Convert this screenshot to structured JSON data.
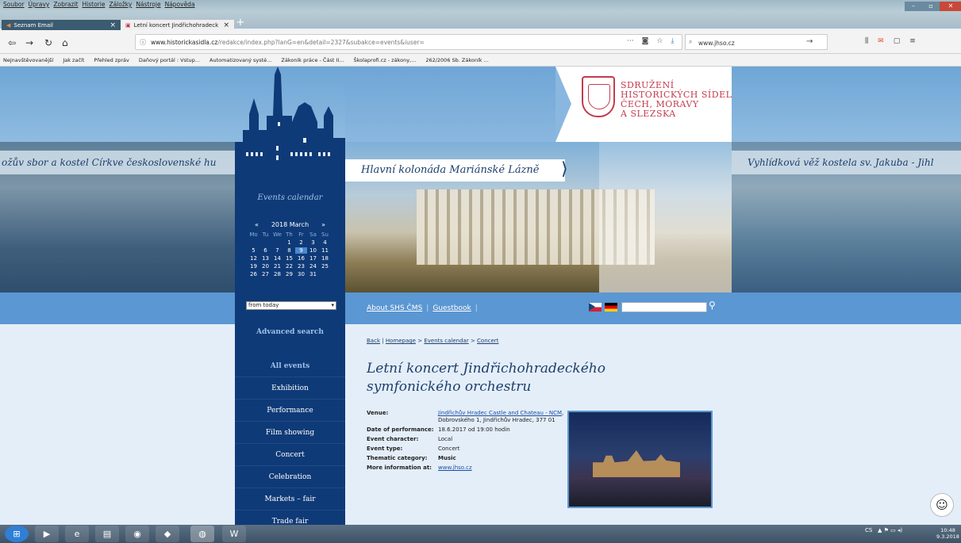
{
  "browser": {
    "menu": [
      "Soubor",
      "Úpravy",
      "Zobrazit",
      "Historie",
      "Záložky",
      "Nástroje",
      "Nápověda"
    ],
    "tabs": [
      {
        "label": "Seznam Email"
      },
      {
        "label": "Letní koncert Jindřichohradeck"
      }
    ],
    "url_domain": "www.historickasidla.cz",
    "url_path": "/redakce/index.php?lanG=en&detail=2327&subakce=events&iuser=",
    "search_value": "www.jhso.cz",
    "bookmarks": [
      "Nejnavštěvovanější",
      "Jak začít",
      "Přehled zpráv",
      "Daňový portál : Vstup...",
      "Automatizovaný systé...",
      "Zákoník práce - Část II...",
      "Školaprofi.cz - zákony,...",
      "262/2006 Sb. Zákoník ..."
    ]
  },
  "header": {
    "org_lines": [
      "SDRUŽENÍ",
      "HISTORICKÝCH SÍDEL",
      "ČECH, MORAVY",
      "A SLEZSKA"
    ],
    "caption_left": "ožův sbor a kostel Církve československé hu",
    "caption_main": "Hlavní kolonáda Mariánské Lázně",
    "caption_right": "Vyhlídková věž kostela sv. Jakuba - Jihl"
  },
  "calendar": {
    "title": "Events calendar",
    "prev": "«",
    "month": "2018 March",
    "next": "»",
    "weekdays": [
      "Mo",
      "Tu",
      "We",
      "Th",
      "Fr",
      "Sa",
      "Su"
    ],
    "days": [
      "",
      "",
      "",
      "1",
      "2",
      "3",
      "4",
      "5",
      "6",
      "7",
      "8",
      "9",
      "10",
      "11",
      "12",
      "13",
      "14",
      "15",
      "16",
      "17",
      "18",
      "19",
      "20",
      "21",
      "22",
      "23",
      "24",
      "25",
      "26",
      "27",
      "28",
      "29",
      "30",
      "31",
      ""
    ],
    "today": "9",
    "filter": "from today"
  },
  "topnav": {
    "about": "About SHS ČMS",
    "guestbook": "Guestbook",
    "sep": "|"
  },
  "sidenav": {
    "advanced": "Advanced search",
    "categories": [
      "All events",
      "Exhibition",
      "Performance",
      "Film showing",
      "Concert",
      "Celebration",
      "Markets – fair",
      "Trade fair"
    ]
  },
  "event": {
    "crumb_back": "Back",
    "crumb_home": "Homepage",
    "crumb_cal": "Events calendar",
    "crumb_current": "Concert",
    "crumb_sep1": "|",
    "crumb_sep2": ">",
    "title_line1": "Letní koncert Jindřichohradeckého",
    "title_line2": "symfonického orchestru",
    "venue_label": "Venue:",
    "venue_link": "Jindřichův Hradec Castle and Chateau - NCM",
    "venue_address": ", Dobrovského 1, Jindřichův Hradec, 377 01",
    "date_label": "Date of performance:",
    "date_value": "18.6.2017 od 19:00 hodin",
    "character_label": "Event character:",
    "character_value": "Local",
    "type_label": "Event type:",
    "type_value": "Concert",
    "thematic_label": "Thematic category:",
    "thematic_value": "Music",
    "more_label": "More information at:",
    "more_link": "www.jhso.cz"
  },
  "taskbar": {
    "lang": "CS",
    "time": "10:48",
    "date": "9.3.2018"
  }
}
